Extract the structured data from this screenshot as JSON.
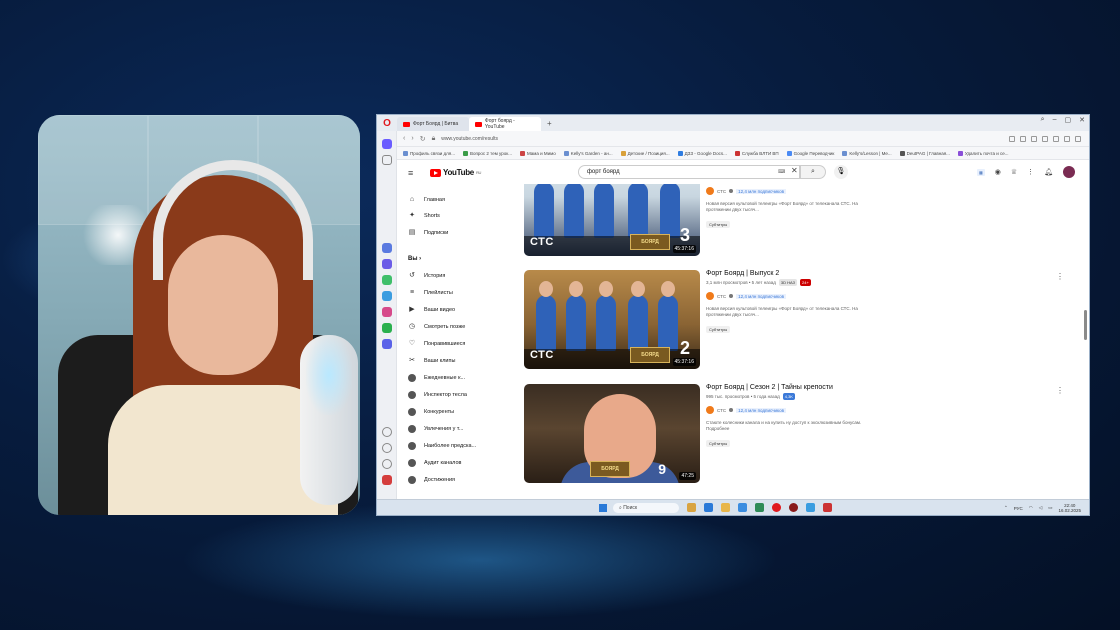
{
  "browser": {
    "tabs": [
      {
        "label": "Форт Боярд | Битва"
      },
      {
        "label": "Форт боярд - YouTube"
      }
    ],
    "url": "www.youtube.com/results",
    "bookmarks": [
      "Профиль связи для...",
      "Вопрос 2 тем урок...",
      "Мама и Мимо",
      "Kelly's Garden - ан...",
      "Детские / Позиция...",
      "ДЗЗ - Google Docs...",
      "Служба ВЛТИ ВП",
      "Google Переводчик",
      "Kelly's/Lesson | Me...",
      "DeutPAG | Главная...",
      "Удалить почта и се..."
    ]
  },
  "youtube": {
    "logo": "YouTube",
    "logo_region": "RU",
    "search_value": "форт боярд",
    "guide": {
      "items": [
        {
          "label": "Главная",
          "icon": "home-icon",
          "glyph": "⌂"
        },
        {
          "label": "Shorts",
          "icon": "shorts-icon",
          "glyph": "✦"
        },
        {
          "label": "Подписки",
          "icon": "subscriptions-icon",
          "glyph": "▤"
        }
      ],
      "you_label": "Вы",
      "you_items": [
        {
          "label": "История",
          "icon": "history-icon",
          "glyph": "↺"
        },
        {
          "label": "Плейлисты",
          "icon": "playlists-icon",
          "glyph": "≡"
        },
        {
          "label": "Ваши видео",
          "icon": "your-videos-icon",
          "glyph": "▶"
        },
        {
          "label": "Смотреть позже",
          "icon": "watch-later-icon",
          "glyph": "◷"
        },
        {
          "label": "Понравившиеся",
          "icon": "liked-icon",
          "glyph": "♡"
        },
        {
          "label": "Ваши клипы",
          "icon": "clips-icon",
          "glyph": "✂"
        }
      ],
      "subscriptions": [
        "Ежедневные к...",
        "Инспектор тесла",
        "Конкуренты",
        "Увлечения у т...",
        "Наиболее предска...",
        "Аудит каналов",
        "Достижения"
      ]
    },
    "results": [
      {
        "title": "",
        "stats": "",
        "channel": "СТС",
        "subs": "12,4 млн подписчиков",
        "desc": "Новая версия культовой телеигры «Форт Боярд» от телеканала СТС. На протяжении двух тысяч...",
        "chip": "Субтитры",
        "episode": "3",
        "duration": "45:37:16",
        "ctc": "СТС",
        "fort": "БОЯРД"
      },
      {
        "title": "Форт Боярд | Выпуск 2",
        "stats": "3,1 млн просмотров • 5 лет назад",
        "badge_gray": "3D НАЗ",
        "badge_red": "24+",
        "channel": "СТС",
        "subs": "12,4 млн подписчиков",
        "desc": "Новая версия культовой телеигры «Форт Боярд» от телеканала СТС. На протяжении двух тысяч...",
        "chip": "Субтитры",
        "episode": "2",
        "duration": "45:37:16",
        "ctc": "СТС",
        "fort": "БОЯРД"
      },
      {
        "title": "Форт Боярд | Сезон 2 | Тайны крепости",
        "stats": "995 тыс. просмотров • 5 года назад",
        "badge_blue": "4,3K",
        "channel": "СТС",
        "subs": "12,4 млн подписчиков",
        "desc": "Стаюте колесники канала и на купить ну доступ к эксклюзивным бонусам. Подробнее",
        "chip": "Субтитры",
        "episode": "9",
        "duration": "47:25",
        "fort": "БОЯРД"
      }
    ]
  },
  "taskbar": {
    "search_placeholder": "Поиск",
    "language": "РУС",
    "time": "22:40",
    "date": "16.02.2025"
  },
  "colors": {
    "background": "#071c3e",
    "youtube_red": "#ff0000",
    "opera_red": "#e0191e",
    "subs_blue": "#3b79d8"
  }
}
